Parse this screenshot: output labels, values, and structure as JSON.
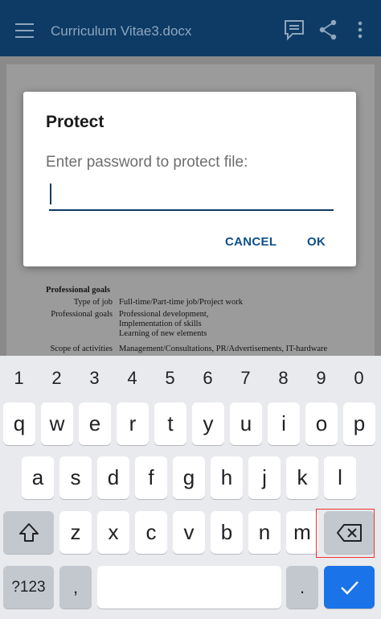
{
  "appbar": {
    "title": "Curriculum Vitae3.docx",
    "icons": [
      "menu-icon",
      "comments-icon",
      "share-icon",
      "more-vert-icon"
    ],
    "color": "#0d3b66"
  },
  "document": {
    "heading": "Professional goals",
    "rows": [
      {
        "label": "Type of job",
        "value": "Full-time/Part-time job/Project work"
      },
      {
        "label": "Professional goals",
        "value": "Professional development,"
      },
      {
        "label": "",
        "value": "Implementation of skills"
      },
      {
        "label": "",
        "value": "Learning of new elements"
      },
      {
        "label": "Scope of activities",
        "value": "Management/Consultations, PR/Advertisements, IT-hardware"
      }
    ]
  },
  "dialog": {
    "title": "Protect",
    "prompt": "Enter password to protect file:",
    "password_value": "",
    "cancel_label": "CANCEL",
    "ok_label": "OK"
  },
  "keyboard": {
    "numbers": [
      "1",
      "2",
      "3",
      "4",
      "5",
      "6",
      "7",
      "8",
      "9",
      "0"
    ],
    "row1": [
      "q",
      "w",
      "e",
      "r",
      "t",
      "y",
      "u",
      "i",
      "o",
      "p"
    ],
    "row2": [
      "a",
      "s",
      "d",
      "f",
      "g",
      "h",
      "j",
      "k",
      "l"
    ],
    "row3": [
      "z",
      "x",
      "c",
      "v",
      "b",
      "n",
      "m"
    ],
    "symbols_label": "?123",
    "comma": ",",
    "period": ".",
    "accent": "#1a73e8"
  }
}
